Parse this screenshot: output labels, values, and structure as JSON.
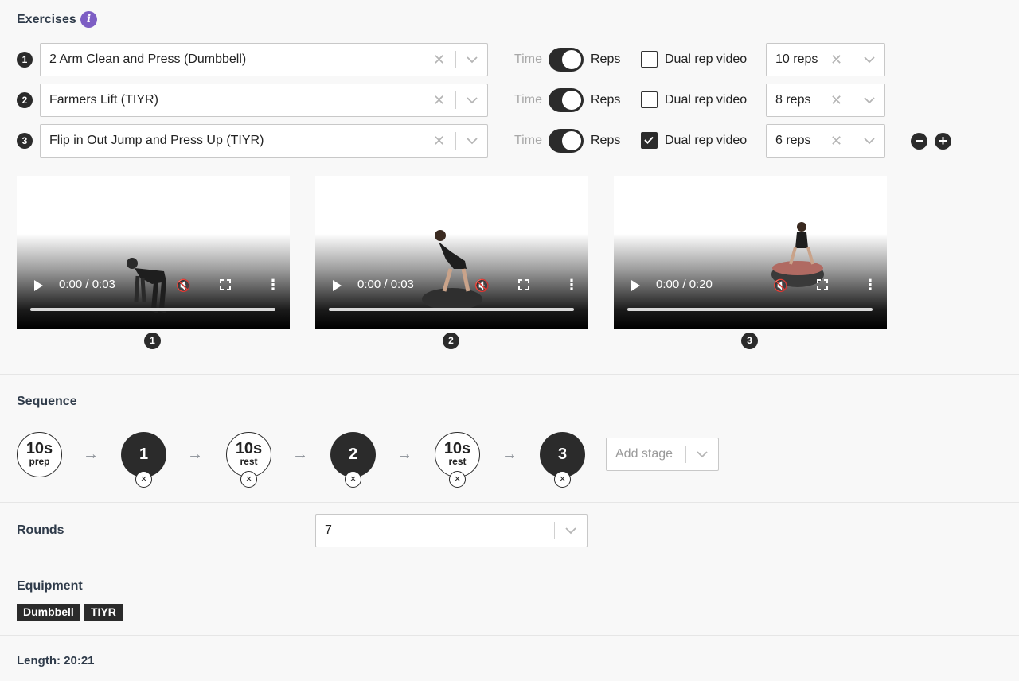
{
  "exercises_section": {
    "title": "Exercises",
    "info_icon": "i",
    "rows": [
      {
        "num": "1",
        "name": "2 Arm Clean and Press (Dumbbell)",
        "time_label": "Time",
        "reps_label": "Reps",
        "dual_label": "Dual rep video",
        "dual_checked": false,
        "reps_value": "10 reps"
      },
      {
        "num": "2",
        "name": "Farmers Lift (TIYR)",
        "time_label": "Time",
        "reps_label": "Reps",
        "dual_label": "Dual rep video",
        "dual_checked": false,
        "reps_value": "8 reps"
      },
      {
        "num": "3",
        "name": "Flip in Out Jump and Press Up (TIYR)",
        "time_label": "Time",
        "reps_label": "Reps",
        "dual_label": "Dual rep video",
        "dual_checked": true,
        "reps_value": "6 reps"
      }
    ],
    "remove_button": "−",
    "add_button": "+"
  },
  "videos": [
    {
      "num": "1",
      "time": "0:00 / 0:03"
    },
    {
      "num": "2",
      "time": "0:00 / 0:03"
    },
    {
      "num": "3",
      "time": "0:00 / 0:20"
    }
  ],
  "sequence": {
    "title": "Sequence",
    "stages": [
      {
        "kind": "timer",
        "value": "10s",
        "label": "prep"
      },
      {
        "kind": "exercise",
        "value": "1"
      },
      {
        "kind": "timer",
        "value": "10s",
        "label": "rest"
      },
      {
        "kind": "exercise",
        "value": "2"
      },
      {
        "kind": "timer",
        "value": "10s",
        "label": "rest"
      },
      {
        "kind": "exercise",
        "value": "3"
      }
    ],
    "arrow": "→",
    "remove_glyph": "×",
    "add_stage_placeholder": "Add stage"
  },
  "rounds": {
    "title": "Rounds",
    "value": "7"
  },
  "equipment": {
    "title": "Equipment",
    "tags": [
      "Dumbbell",
      "TIYR"
    ]
  },
  "length": {
    "text": "Length: 20:21"
  },
  "colors": {
    "accent": "#7d5ec4",
    "dark": "#2b2b2b",
    "background": "#f8f8f8"
  }
}
